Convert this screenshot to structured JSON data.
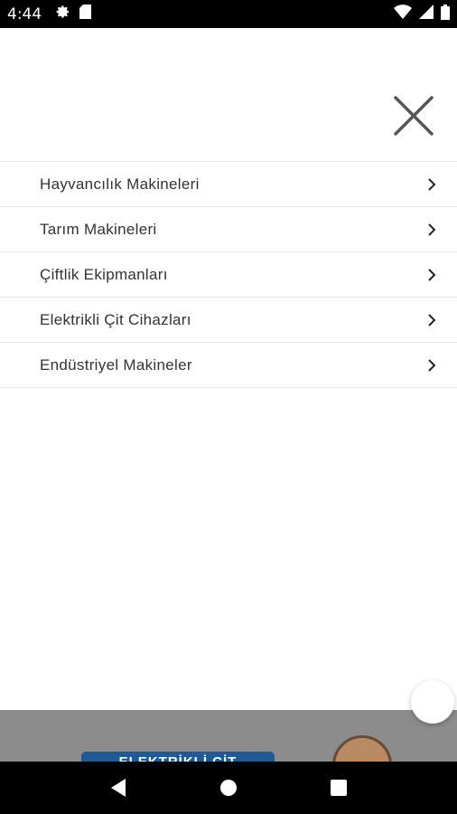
{
  "status_bar": {
    "time": "4:44",
    "icons": [
      "settings-icon",
      "sd-card-icon",
      "wifi-icon",
      "signal-icon",
      "battery-icon"
    ]
  },
  "menu": {
    "close_icon": "close-icon",
    "items": [
      {
        "label": "Hayvancılık Makineleri",
        "icon": "chevron-right-icon"
      },
      {
        "label": "Tarım Makineleri",
        "icon": "chevron-right-icon"
      },
      {
        "label": "Çiftlik Ekipmanları",
        "icon": "chevron-right-icon"
      },
      {
        "label": "Elektrikli Çit Cihazları",
        "icon": "chevron-right-icon"
      },
      {
        "label": "Endüstriyel Makineler",
        "icon": "chevron-right-icon"
      }
    ]
  },
  "banner": {
    "text": "ELEKTRİKLİ ÇİT CİHAZLARI"
  },
  "nav_bar": {
    "icons": [
      "back-icon",
      "home-icon",
      "recents-icon"
    ]
  },
  "colors": {
    "status_bar": "#000000",
    "nav_bar": "#000000",
    "divider": "#e6e6e6",
    "text": "#333333",
    "banner_pill": "#1e5a96"
  }
}
